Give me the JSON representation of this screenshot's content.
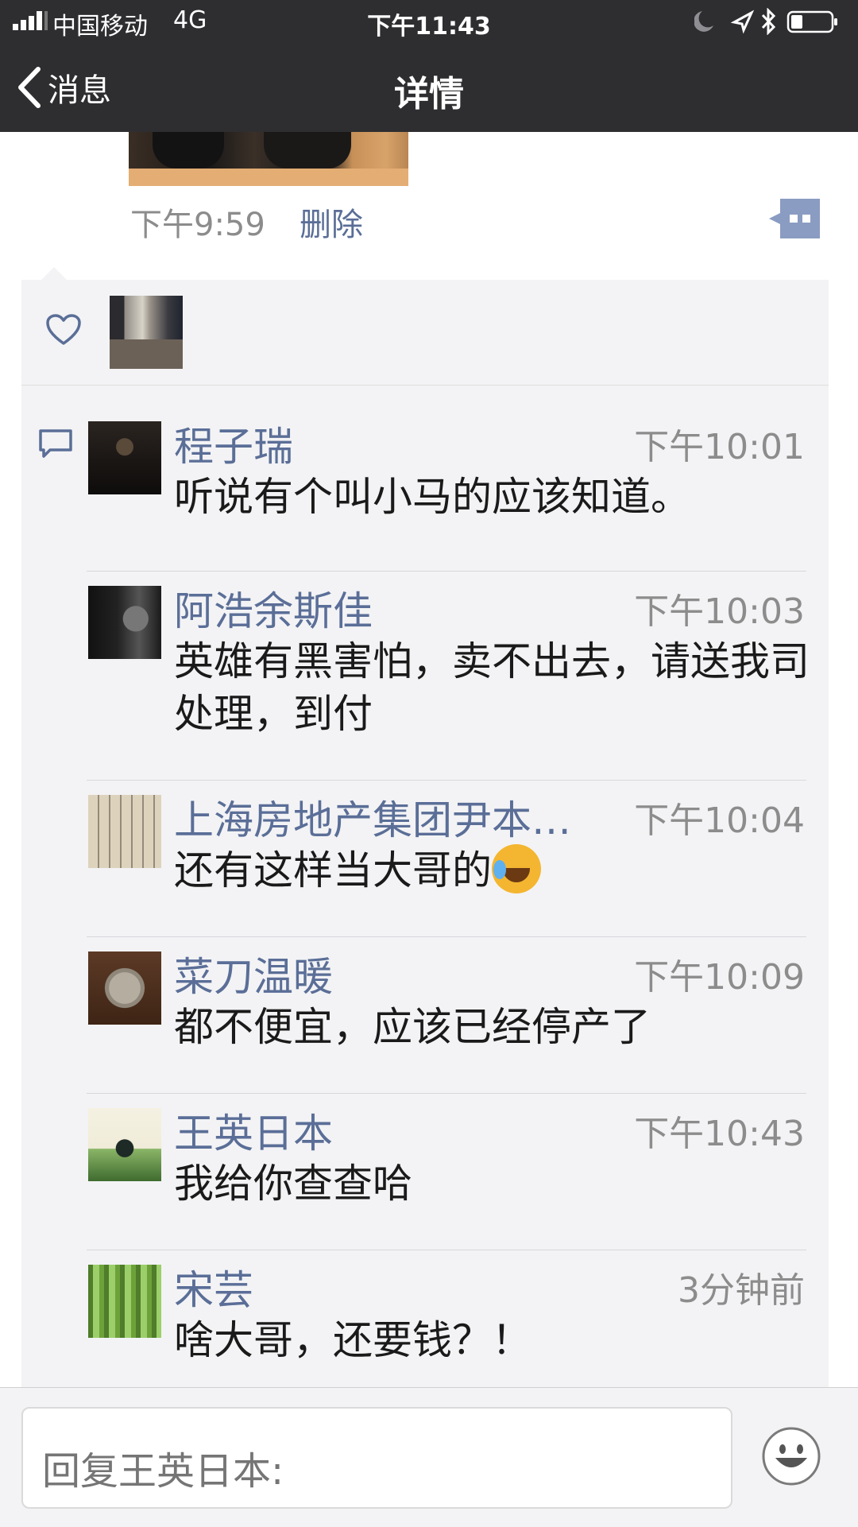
{
  "status_bar": {
    "carrier": "中国移动",
    "network": "4G",
    "time": "下午11:43"
  },
  "nav": {
    "back_label": "消息",
    "title": "详情"
  },
  "post": {
    "time": "下午9:59",
    "delete_label": "删除"
  },
  "comments": [
    {
      "name": "程子瑞",
      "time": "下午10:01",
      "text": "听说有个叫小马的应该知道。"
    },
    {
      "name": "阿浩余斯佳",
      "time": "下午10:03",
      "text": "英雄有黑害怕，卖不出去，请送我司处理，到付"
    },
    {
      "name": "上海房地产集团尹本…",
      "time": "下午10:04",
      "text": "还有这样当大哥的"
    },
    {
      "name": "菜刀温暖",
      "time": "下午10:09",
      "text": "都不便宜，应该已经停产了"
    },
    {
      "name": "王英日本",
      "time": "下午10:43",
      "text": "我给你查查哈"
    },
    {
      "name": "宋芸",
      "time": "3分钟前",
      "text": "啥大哥，还要钱？！"
    }
  ],
  "reply": {
    "placeholder": "回复王英日本:"
  },
  "icons": {
    "like": "heart-outline-icon",
    "comment": "speech-bubble-icon",
    "more": "more-dots-icon",
    "emoji": "smiley-icon",
    "back": "chevron-left-icon"
  },
  "colors": {
    "nav_background": "#2e2e31",
    "link_blue": "#5a6e97",
    "panel_background": "#f3f3f5",
    "time_gray": "#8c8c8c"
  }
}
